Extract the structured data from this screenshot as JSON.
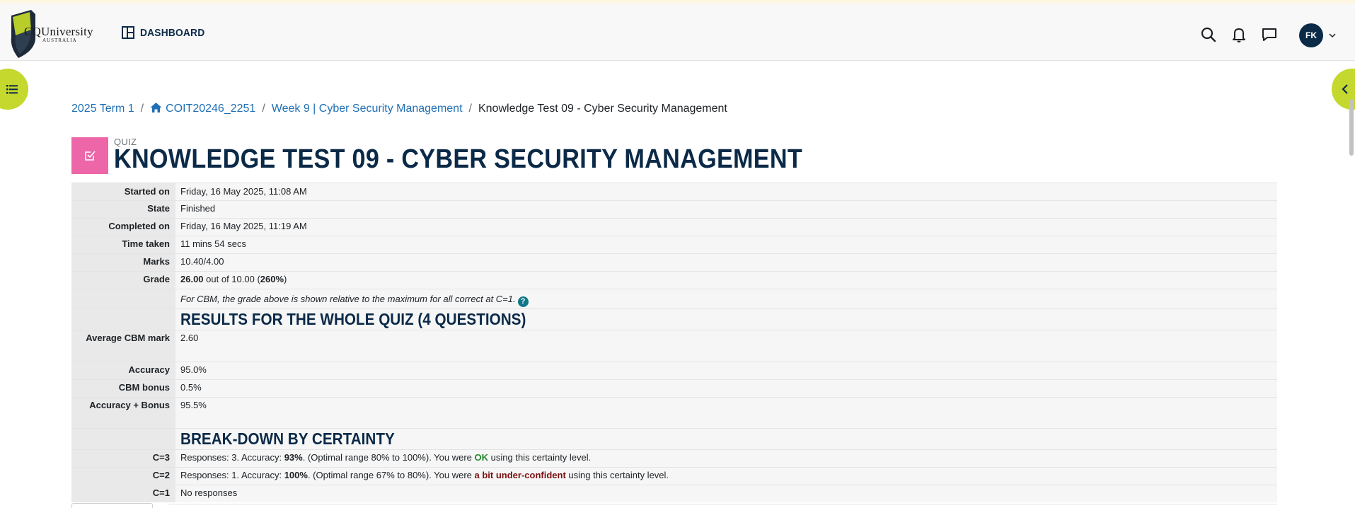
{
  "header": {
    "logo_text": "CQUniversity",
    "logo_subtext": "AUSTRALIA",
    "dashboard_label": "DASHBOARD",
    "avatar_initials": "FK"
  },
  "breadcrumb": {
    "items": [
      "2025 Term 1",
      "COIT20246_2251",
      "Week 9 | Cyber Security Management"
    ],
    "current": "Knowledge Test 09 - Cyber Security Management",
    "separator": "/"
  },
  "page": {
    "module_type": "QUIZ",
    "title": "KNOWLEDGE TEST 09 - CYBER SECURITY MANAGEMENT"
  },
  "summary": {
    "started_label": "Started on",
    "started_value": "Friday, 16 May 2025, 11:08 AM",
    "state_label": "State",
    "state_value": "Finished",
    "completed_label": "Completed on",
    "completed_value": "Friday, 16 May 2025, 11:19 AM",
    "time_label": "Time taken",
    "time_value": "11 mins 54 secs",
    "marks_label": "Marks",
    "marks_value": "10.40/4.00",
    "grade_label": "Grade",
    "grade_score": "26.00",
    "grade_mid": " out of 10.00 (",
    "grade_percent": "260%",
    "grade_end": ")",
    "cbm_note": "For CBM, the grade above is shown relative to the maximum for all correct at C=1.",
    "help_icon_glyph": "?",
    "results_heading": "RESULTS FOR THE WHOLE QUIZ (4 QUESTIONS)",
    "avg_cbm_label": "Average CBM mark",
    "avg_cbm_value": "2.60",
    "accuracy_label": "Accuracy",
    "accuracy_value": "95.0%",
    "cbm_bonus_label": "CBM bonus",
    "cbm_bonus_value": "0.5%",
    "acc_bonus_label": "Accuracy + Bonus",
    "acc_bonus_value": "95.5%",
    "breakdown_heading": "BREAK-DOWN BY CERTAINTY",
    "c3_label": "C=3",
    "c3_pre": "Responses: 3. Accuracy: ",
    "c3_acc": "93%",
    "c3_mid": ". (Optimal range 80% to 100%). You were ",
    "c3_verdict": "OK",
    "c3_post": " using this certainty level.",
    "c2_label": "C=2",
    "c2_pre": "Responses: 1. Accuracy: ",
    "c2_acc": "100%",
    "c2_mid": ". (Optimal range 67% to 80%). You were ",
    "c2_verdict": "a bit under-confident",
    "c2_post": " using this certainty level.",
    "c1_label": "C=1",
    "c1_value": "No responses"
  },
  "icons": {
    "dashboard": "dashboard-grid-icon",
    "search": "search-icon",
    "notifications": "bell-icon",
    "messages": "chat-icon",
    "course_index": "list-icon",
    "block_drawer": "chevron-left-icon",
    "quiz": "checkbox-icon",
    "home": "home-icon"
  },
  "colors": {
    "brand_lime": "#c5d82e",
    "navy": "#0b2a48",
    "link": "#1f6fb5",
    "quiz_pink": "#ec66a8",
    "ok_green": "#268a2e",
    "under_red": "#7a1010"
  }
}
